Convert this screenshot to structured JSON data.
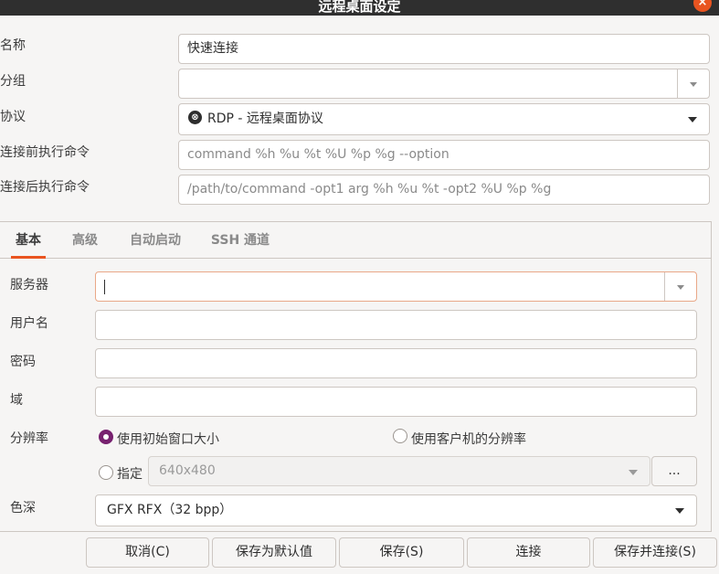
{
  "window": {
    "title": "远程桌面设定",
    "close_icon": "close-icon"
  },
  "form": {
    "name_label": "名称",
    "name_value": "快速连接",
    "group_label": "分组",
    "group_value": "",
    "protocol_label": "协议",
    "protocol_value": "RDP - 远程桌面协议",
    "protocol_icon": "⊗",
    "pre_cmd_label": "连接前执行命令",
    "pre_cmd_placeholder": "command %h %u %t %U %p %g --option",
    "post_cmd_label": "连接后执行命令",
    "post_cmd_placeholder": "/path/to/command -opt1 arg %h %u %t -opt2 %U %p %g"
  },
  "tabs": [
    "基本",
    "高级",
    "自动启动",
    "SSH 通道"
  ],
  "basic": {
    "server_label": "服务器",
    "server_value": "",
    "username_label": "用户名",
    "password_label": "密码",
    "domain_label": "域",
    "resolution_label": "分辨率",
    "res_option_initial": "使用初始窗口大小",
    "res_option_client": "使用客户机的分辨率",
    "res_option_custom": "指定",
    "res_custom_value": "640x480",
    "res_more_button": "...",
    "color_depth_label": "色深",
    "color_depth_value": "GFX RFX（32 bpp）"
  },
  "buttons": {
    "cancel": "取消(C)",
    "save_default": "保存为默认值",
    "save": "保存(S)",
    "connect": "连接",
    "save_connect": "保存并连接(S)"
  },
  "colors": {
    "accent": "#e95420",
    "radio_checked": "#77216f",
    "titlebar": "#2f2f2f"
  }
}
